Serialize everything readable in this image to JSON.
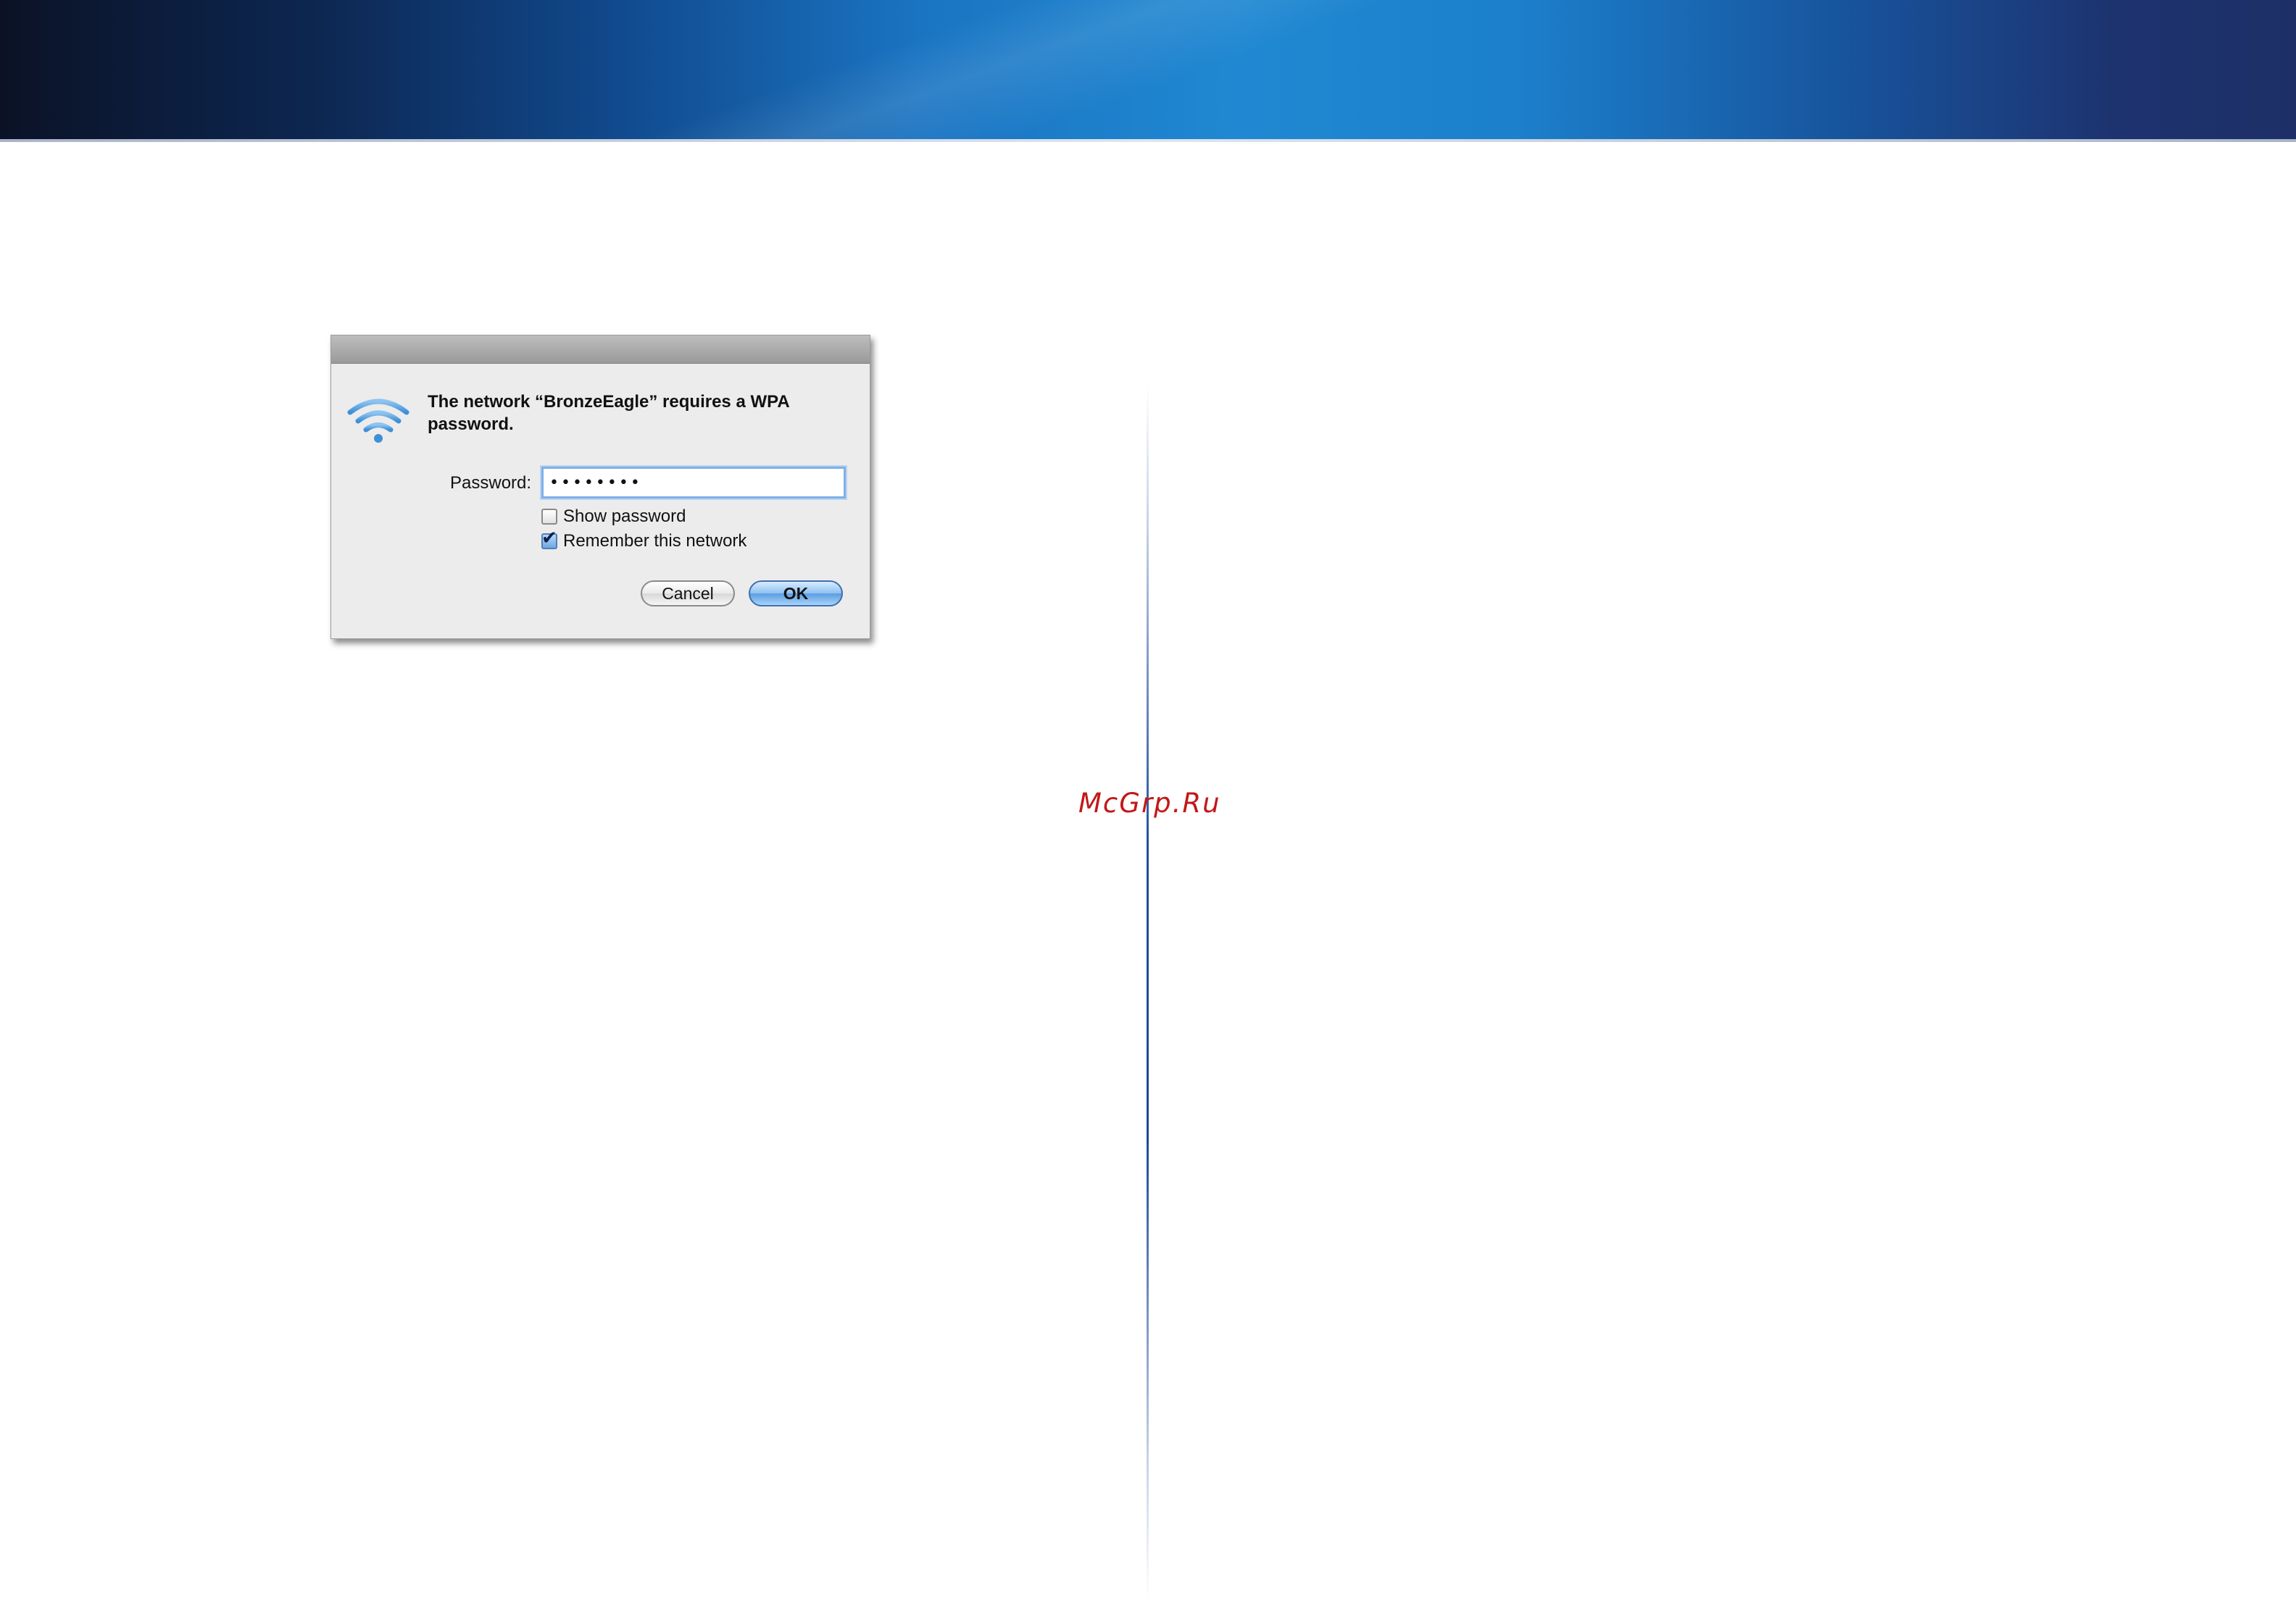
{
  "watermark": "McGrp.Ru",
  "dialog": {
    "message": "The network “BronzeEagle” requires a WPA password.",
    "password_label": "Password:",
    "password_value": "••••••••",
    "show_password_label": "Show password",
    "show_password_checked": false,
    "remember_label": "Remember this network",
    "remember_checked": true,
    "cancel_label": "Cancel",
    "ok_label": "OK",
    "icon": "wifi-icon"
  },
  "colors": {
    "banner_blue": "#1a74c2",
    "divider_blue": "#1f4f9c",
    "watermark_red": "#c21818",
    "focus_ring": "#7fb0e6"
  }
}
